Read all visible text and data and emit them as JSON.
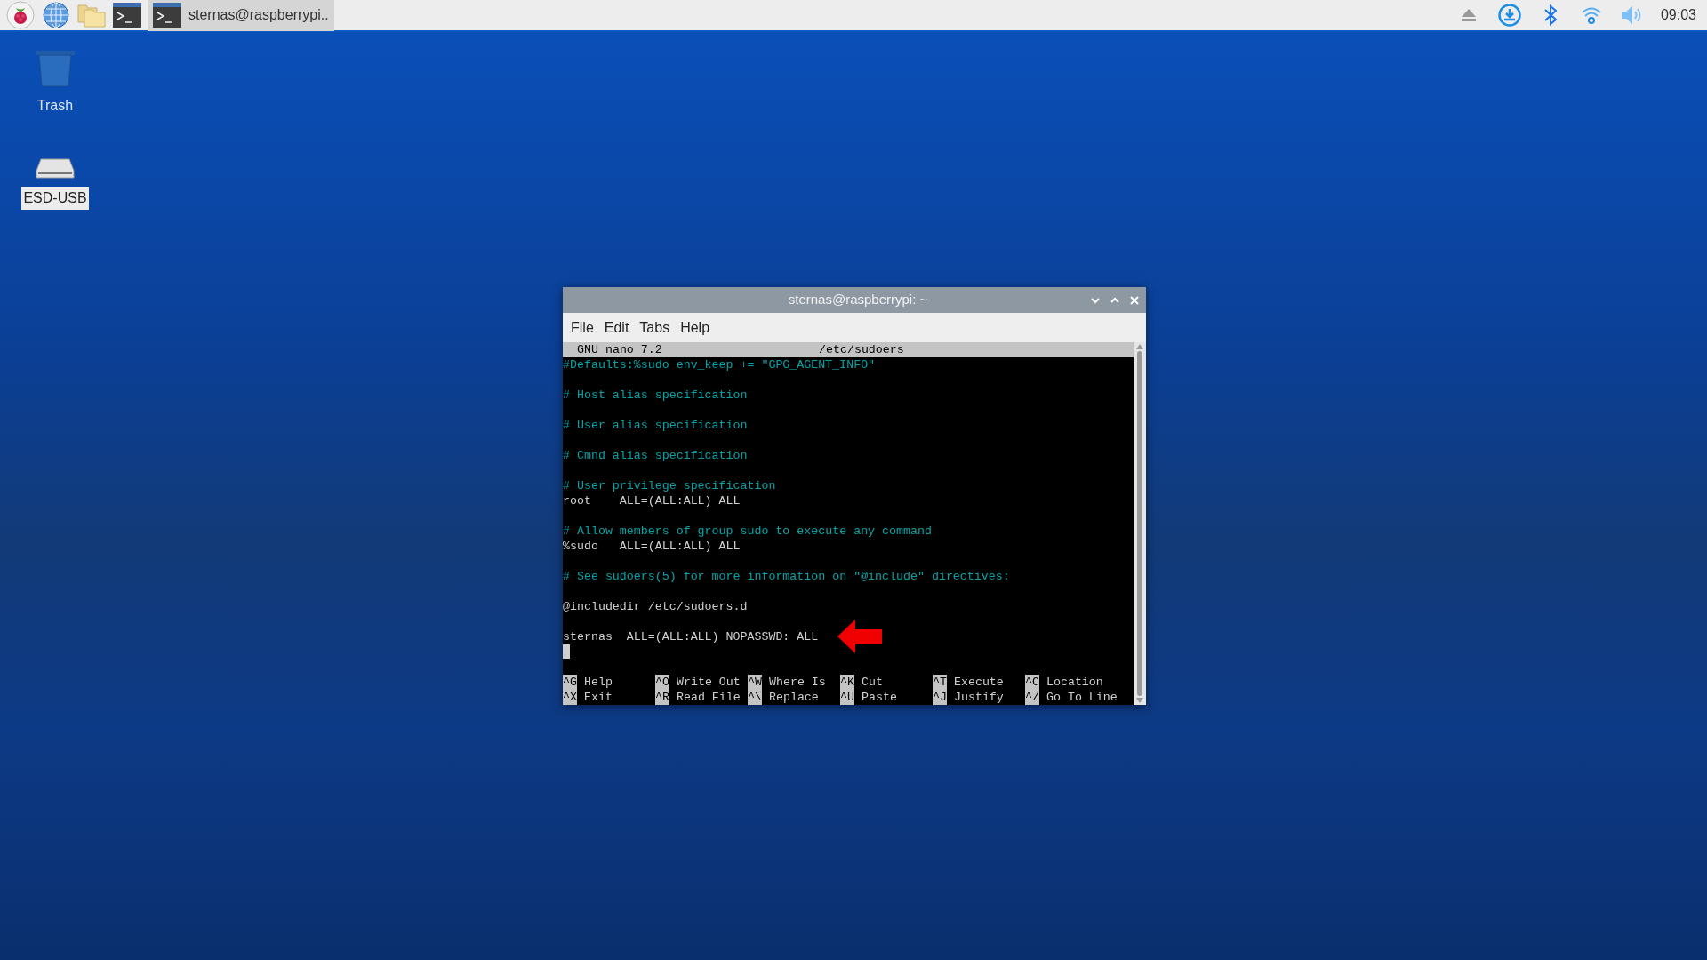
{
  "taskbar": {
    "launchers": [
      {
        "kind": "menu"
      },
      {
        "kind": "browser"
      },
      {
        "kind": "files"
      },
      {
        "kind": "terminal"
      }
    ],
    "tasks": [
      {
        "label": "sternas@raspberrypi..",
        "selected": true
      }
    ],
    "tray": [
      {
        "kind": "eject"
      },
      {
        "kind": "download"
      },
      {
        "kind": "bluetooth"
      },
      {
        "kind": "wifi"
      },
      {
        "kind": "volume"
      }
    ],
    "clock": "09:03"
  },
  "desktop_icons": [
    {
      "kind": "trash",
      "label": "Trash",
      "selected": false
    },
    {
      "kind": "drive",
      "label": "ESD-USB",
      "selected": true
    }
  ],
  "window": {
    "title": "sternas@raspberrypi: ~",
    "menu": [
      "File",
      "Edit",
      "Tabs",
      "Help"
    ],
    "nano": {
      "program": "GNU nano 7.2",
      "filename": "/etc/sudoers",
      "lines": [
        {
          "kind": "comment",
          "text": "#Defaults:%sudo env_keep += \"GPG_AGENT_INFO\""
        },
        {
          "kind": "blank"
        },
        {
          "kind": "comment",
          "text": "# Host alias specification"
        },
        {
          "kind": "blank"
        },
        {
          "kind": "comment",
          "text": "# User alias specification"
        },
        {
          "kind": "blank"
        },
        {
          "kind": "comment",
          "text": "# Cmnd alias specification"
        },
        {
          "kind": "blank"
        },
        {
          "kind": "comment",
          "text": "# User privilege specification"
        },
        {
          "kind": "text",
          "text": "root    ALL=(ALL:ALL) ALL"
        },
        {
          "kind": "blank"
        },
        {
          "kind": "comment",
          "text": "# Allow members of group sudo to execute any command"
        },
        {
          "kind": "text",
          "text": "%sudo   ALL=(ALL:ALL) ALL"
        },
        {
          "kind": "blank"
        },
        {
          "kind": "comment",
          "text": "# See sudoers(5) for more information on \"@include\" directives:"
        },
        {
          "kind": "blank"
        },
        {
          "kind": "text",
          "text": "@includedir /etc/sudoers.d"
        },
        {
          "kind": "blank"
        },
        {
          "kind": "text",
          "text": "sternas  ALL=(ALL:ALL) NOPASSWD: ALL",
          "marked": true
        },
        {
          "kind": "cursor"
        }
      ],
      "shortcuts": [
        [
          {
            "key": "^G",
            "label": "Help"
          },
          {
            "key": "^O",
            "label": "Write Out"
          },
          {
            "key": "^W",
            "label": "Where Is"
          },
          {
            "key": "^K",
            "label": "Cut"
          },
          {
            "key": "^T",
            "label": "Execute"
          },
          {
            "key": "^C",
            "label": "Location"
          }
        ],
        [
          {
            "key": "^X",
            "label": "Exit"
          },
          {
            "key": "^R",
            "label": "Read File"
          },
          {
            "key": "^\\",
            "label": "Replace"
          },
          {
            "key": "^U",
            "label": "Paste"
          },
          {
            "key": "^J",
            "label": "Justify"
          },
          {
            "key": "^/",
            "label": "Go To Line"
          }
        ]
      ]
    }
  }
}
